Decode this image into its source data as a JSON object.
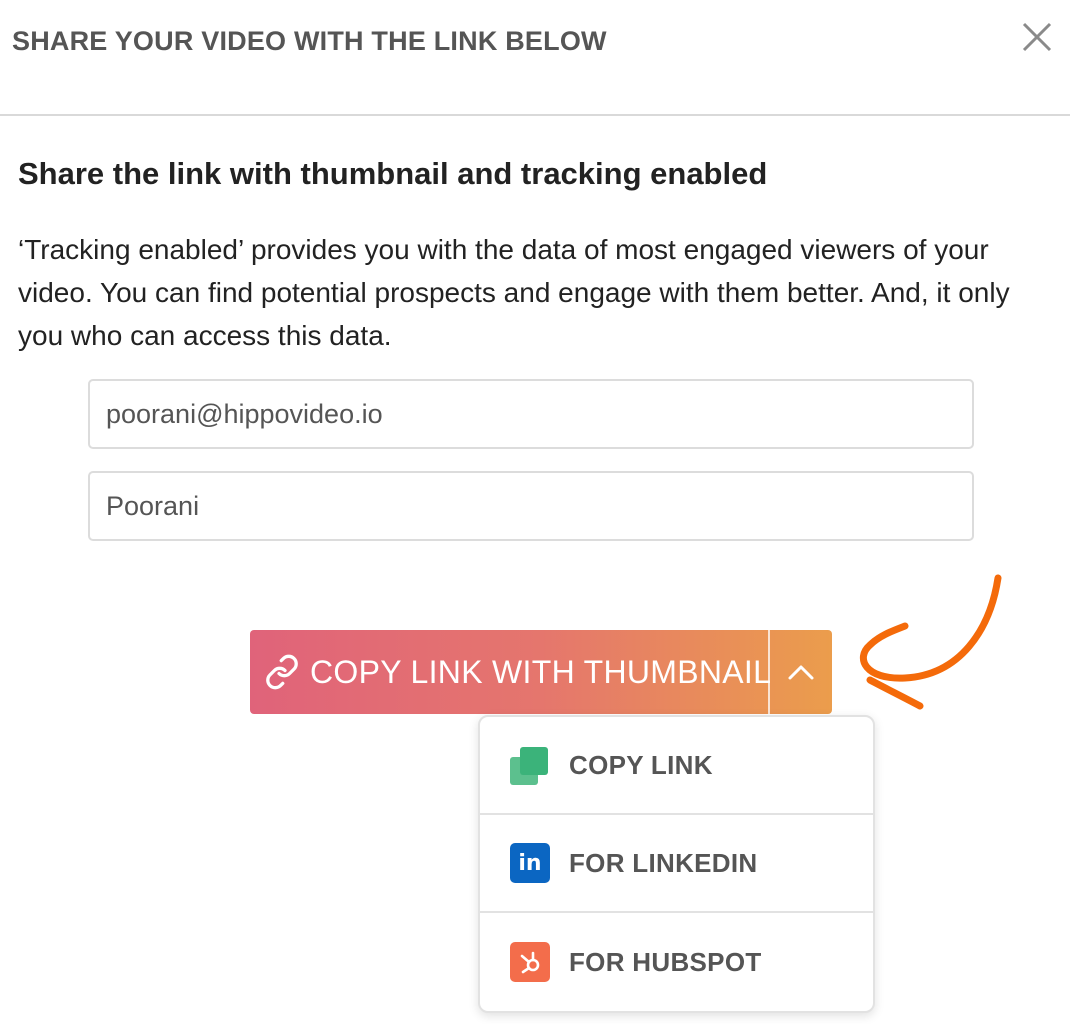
{
  "modal": {
    "title": "SHARE YOUR VIDEO WITH THE LINK BELOW",
    "close_icon": "close-icon"
  },
  "section": {
    "heading": "Share the link with thumbnail and tracking enabled",
    "description": "‘Tracking enabled’ provides you with the data of most engaged viewers of your video. You can find potential prospects and engage with them better. And, it only you who can access this data."
  },
  "form": {
    "email_value": "poorani@hippovideo.io",
    "name_value": "Poorani"
  },
  "share_button": {
    "label": "COPY LINK WITH THUMBNAIL",
    "icon": "link-icon",
    "toggle_icon": "chevron-up-icon",
    "gradient_start": "#e0637a",
    "gradient_end": "#eb9d4c"
  },
  "dropdown": {
    "items": [
      {
        "label": "COPY LINK",
        "icon": "copy-icon",
        "color": "#3bb37a"
      },
      {
        "label": "FOR LINKEDIN",
        "icon": "linkedin-icon",
        "color": "#0b66c2"
      },
      {
        "label": "FOR HUBSPOT",
        "icon": "hubspot-icon",
        "color": "#f36d4b"
      }
    ]
  },
  "annotation": {
    "color": "#f46a0a",
    "icon": "arrow-annotation-icon"
  }
}
